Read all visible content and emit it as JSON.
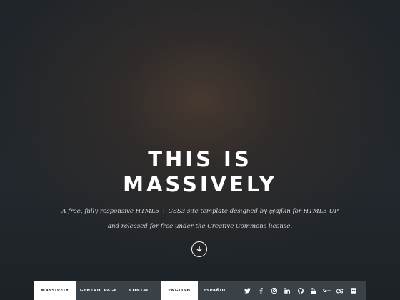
{
  "intro": {
    "title_line1": "THIS IS",
    "title_line2": "MASSIVELY",
    "text_line1": "A free, fully responsive HTML5 + CSS3 site template designed by @ajlkn for HTML5 UP",
    "text_line2": "and released for free under the Creative Commons license."
  },
  "nav": {
    "links": [
      {
        "label": "MASSIVELY",
        "active": true
      },
      {
        "label": "GENERIC PAGE",
        "active": false
      },
      {
        "label": "CONTACT",
        "active": false
      },
      {
        "label": "ENGLISH",
        "active": true
      },
      {
        "label": "ESPAÑOL",
        "active": false
      }
    ],
    "icons": [
      "twitter-icon",
      "facebook-icon",
      "instagram-icon",
      "linkedin-icon",
      "github-icon",
      "youtube-icon",
      "google-plus-icon",
      "lastfm-icon",
      "flickr-icon"
    ],
    "icon_text": {
      "google_plus": "G+"
    }
  },
  "colors": {
    "nav_bg": "#3a4147",
    "active_bg": "#ffffff",
    "page_bg": "#1d2327"
  }
}
